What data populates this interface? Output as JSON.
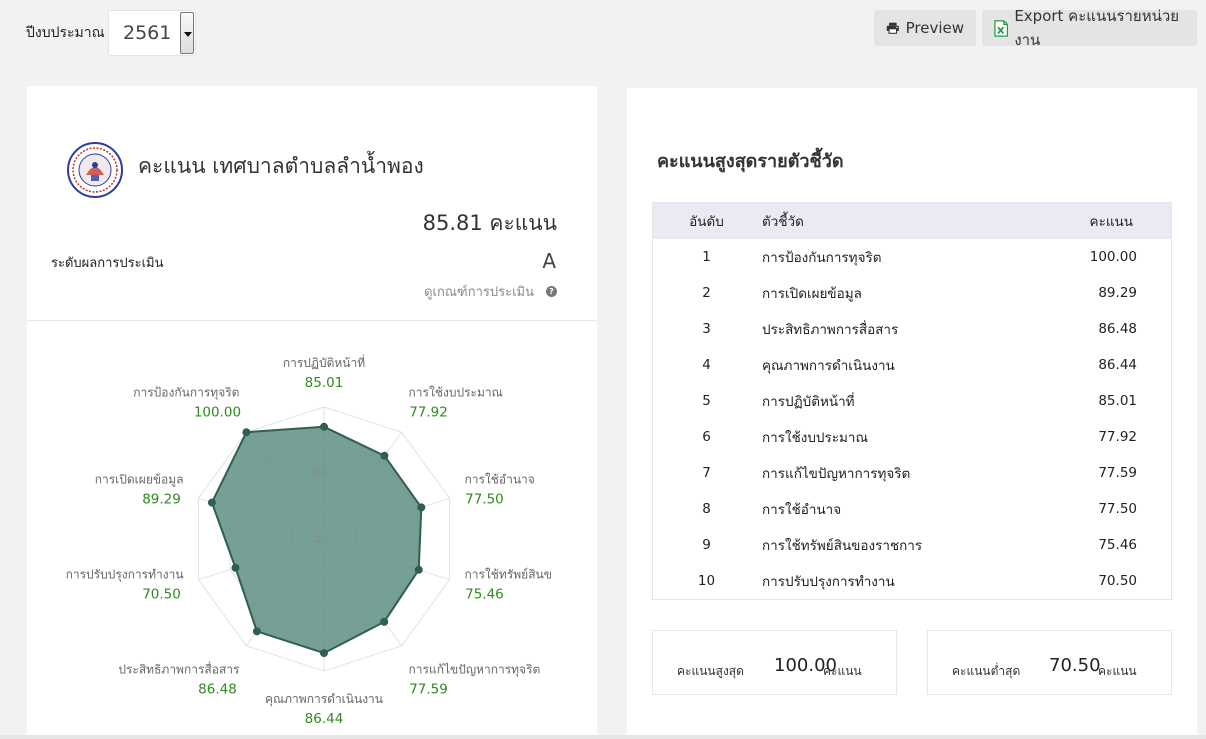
{
  "topbar": {
    "year_label": "ปีงบประมาณ",
    "year_value": "2561",
    "preview_label": "Preview",
    "export_label": "Export คะแนนรายหน่วยงาน"
  },
  "summary": {
    "org_title": "คะแนน เทศบาลตำบลลำน้ำพอง",
    "total_score": "85.81 คะแนน",
    "level_label": "ระดับผลการประเมิน",
    "level_value": "A",
    "criteria_link": "ดูเกณฑ์การประเมิน"
  },
  "chart_data": {
    "type": "radar",
    "r_ticks": [
      "0",
      "50"
    ],
    "rlim": [
      0,
      100
    ],
    "axes": [
      {
        "label": "การปฏิบัติหน้าที่",
        "value": 85.01
      },
      {
        "label": "การใช้งบประมาณ",
        "value": 77.92
      },
      {
        "label": "การใช้อำนาจ",
        "value": 77.5
      },
      {
        "label": "การใช้ทรัพย์สินข",
        "value": 75.46
      },
      {
        "label": "การแก้ไขปัญหาการทุจริต",
        "value": 77.59
      },
      {
        "label": "คุณภาพการดำเนินงาน",
        "value": 86.44
      },
      {
        "label": "ประสิทธิภาพการสื่อสาร",
        "value": 86.48
      },
      {
        "label": "การปรับปรุงการทำงาน",
        "value": 70.5
      },
      {
        "label": "การเปิดเผยข้อมูล",
        "value": 89.29
      },
      {
        "label": "การป้องกันการทุจริต",
        "value": 100.0
      }
    ],
    "value_labels": [
      "85.01",
      "77.92",
      "77.50",
      "75.46",
      "77.59",
      "86.44",
      "86.48",
      "70.50",
      "89.29",
      "100.00"
    ],
    "colors": {
      "fill": "#5e8f82",
      "stroke": "#2f5f52",
      "point": "#2f5f52",
      "value_text": "#2e8b1e",
      "label_text": "#666666",
      "grid": "#e2e2e2"
    }
  },
  "ranking": {
    "title": "คะแนนสูงสุดรายตัวชี้วัด",
    "headers": {
      "rank": "อันดับ",
      "name": "ตัวชี้วัด",
      "score": "คะแนน"
    },
    "rows": [
      {
        "rank": "1",
        "name": "การป้องกันการทุจริต",
        "score": "100.00"
      },
      {
        "rank": "2",
        "name": "การเปิดเผยข้อมูล",
        "score": "89.29"
      },
      {
        "rank": "3",
        "name": "ประสิทธิภาพการสื่อสาร",
        "score": "86.48"
      },
      {
        "rank": "4",
        "name": "คุณภาพการดำเนินงาน",
        "score": "86.44"
      },
      {
        "rank": "5",
        "name": "การปฏิบัติหน้าที่",
        "score": "85.01"
      },
      {
        "rank": "6",
        "name": "การใช้งบประมาณ",
        "score": "77.92"
      },
      {
        "rank": "7",
        "name": "การแก้ไขปัญหาการทุจริต",
        "score": "77.59"
      },
      {
        "rank": "8",
        "name": "การใช้อำนาจ",
        "score": "77.50"
      },
      {
        "rank": "9",
        "name": "การใช้ทรัพย์สินของราชการ",
        "score": "75.46"
      },
      {
        "rank": "10",
        "name": "การปรับปรุงการทำงาน",
        "score": "70.50"
      }
    ]
  },
  "minmax": {
    "max_label": "คะแนนสูงสุด",
    "max_value": "100.00",
    "min_label": "คะแนนต่ำสุด",
    "min_value": "70.50",
    "unit": "คะแนน"
  },
  "colors": {
    "page_bg": "#f2f2f4",
    "table_header_bg": "#ebeaf4",
    "button_bg": "#e4e4e6",
    "excel_green": "#1e9e3e"
  }
}
